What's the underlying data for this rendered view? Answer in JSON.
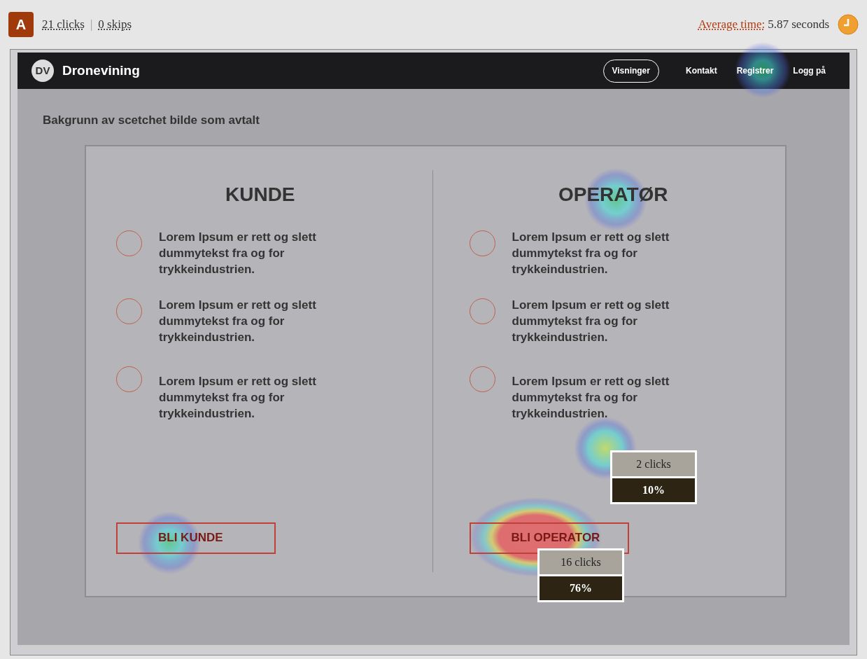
{
  "header": {
    "badge": "A",
    "clicks": "21 clicks",
    "separator": "|",
    "skips": "0 skips",
    "average_label": "Average time:",
    "average_value": "5.87 seconds"
  },
  "site": {
    "logo": "DV",
    "name": "Dronevining",
    "nav": [
      {
        "label": "Visninger",
        "kind": "pill"
      },
      {
        "label": "Kontakt",
        "kind": "link"
      },
      {
        "label": "Registrer",
        "kind": "link"
      },
      {
        "label": "Logg på",
        "kind": "link"
      }
    ]
  },
  "page": {
    "caption": "Bakgrunn av scetchet bilde som avtalt",
    "columns": [
      {
        "title": "KUNDE",
        "items": [
          "Lorem Ipsum er rett og slett dummytekst fra og for trykkeindustrien.",
          "Lorem Ipsum er rett og slett dummytekst fra og for trykkeindustrien.",
          "Lorem Ipsum er rett og slett dummytekst fra og for trykkeindustrien."
        ],
        "button": "BLI KUNDE"
      },
      {
        "title": "OPERATØR",
        "items": [
          "Lorem Ipsum er rett og slett dummytekst fra og for trykkeindustrien.",
          "Lorem Ipsum er rett og slett dummytekst fra og for trykkeindustrien.",
          "Lorem Ipsum er rett og slett dummytekst fra og for trykkeindustrien."
        ],
        "button": "BLI OPERATOR"
      }
    ]
  },
  "click_labels": [
    {
      "clicks": "2 clicks",
      "percent": "10%"
    },
    {
      "clicks": "16 clicks",
      "percent": "76%"
    }
  ]
}
